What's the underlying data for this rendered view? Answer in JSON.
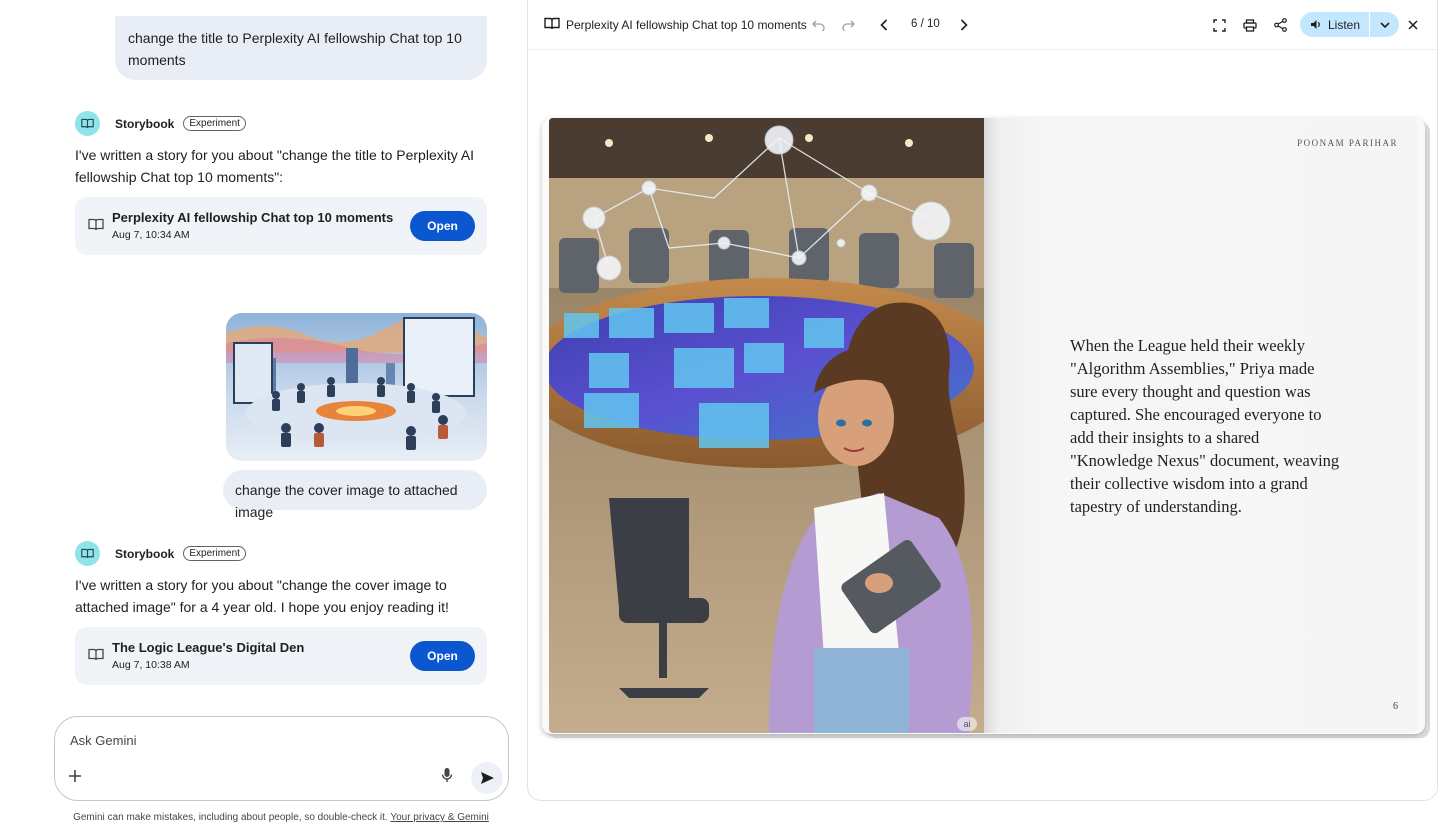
{
  "chat": {
    "messages": [
      {
        "type": "user",
        "text": "change the title to Perplexity AI fellowship Chat top 10 moments"
      },
      {
        "type": "bot",
        "name": "Storybook",
        "badge": "Experiment",
        "text": "I've written a story for you about \"change the title to Perplexity AI fellowship Chat top 10 moments\":",
        "card": {
          "title": "Perplexity AI fellowship Chat top 10 moments",
          "date": "Aug 7, 10:34 AM",
          "button": "Open"
        }
      },
      {
        "type": "user_image",
        "description": ""
      },
      {
        "type": "user",
        "text": "change the cover image to attached image"
      },
      {
        "type": "bot",
        "name": "Storybook",
        "badge": "Experiment",
        "text": "I've written a story for you about \"change the cover image to attached image\" for a 4 year old. I hope you enjoy reading it!",
        "card": {
          "title": "The Logic League's Digital Den",
          "date": "Aug 7, 10:38 AM",
          "button": "Open"
        }
      }
    ],
    "composer": {
      "placeholder": "Ask Gemini"
    },
    "disclaimer": {
      "text": "Gemini can make mistakes, including about people, so double-check it.",
      "link": "Your privacy & Gemini"
    }
  },
  "viewer": {
    "title": "Perplexity AI fellowship Chat top 10 moments",
    "page_indicator": "6 / 10",
    "listen_label": "Listen",
    "book": {
      "author": "POONAM PARIHAR",
      "story_text": "When the League held their weekly \"Algorithm Assemblies,\" Priya made sure every thought and question was captured. She encouraged everyone to add their insights to a shared \"Knowledge Nexus\" document, weaving their collective wisdom into a grand tapestry of understanding.",
      "page_number": "6",
      "ai_mark": "ai"
    }
  },
  "colors": {
    "accent": "#0b57d0",
    "listen_bg": "#c2e7ff",
    "bubble": "#e9eef6",
    "card": "#f0f4f9",
    "avatar": "#8fe3ea"
  }
}
